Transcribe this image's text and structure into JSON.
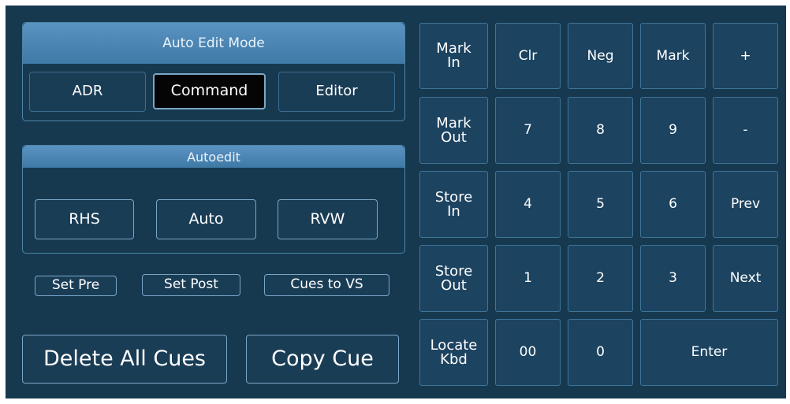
{
  "auto_edit_mode": {
    "title": "Auto Edit Mode",
    "buttons": [
      "ADR",
      "Command",
      "Editor"
    ],
    "selected": "Command"
  },
  "autoedit": {
    "title": "Autoedit",
    "buttons": [
      "RHS",
      "Auto",
      "RVW"
    ]
  },
  "small_buttons": [
    "Set Pre",
    "Set Post",
    "Cues to VS"
  ],
  "large_buttons": [
    "Delete All Cues",
    "Copy Cue"
  ],
  "keypad": {
    "mark_in": "Mark\nIn",
    "mark_out": "Mark\nOut",
    "store_in": "Store\nIn",
    "store_out": "Store\nOut",
    "locate_kbd": "Locate\nKbd",
    "clr": "Clr",
    "neg": "Neg",
    "mark": "Mark",
    "plus": "+",
    "minus": "-",
    "prev": "Prev",
    "next": "Next",
    "enter": "Enter",
    "k7": "7",
    "k8": "8",
    "k9": "9",
    "k4": "4",
    "k5": "5",
    "k6": "6",
    "k1": "1",
    "k2": "2",
    "k3": "3",
    "k00": "00",
    "k0": "0"
  }
}
